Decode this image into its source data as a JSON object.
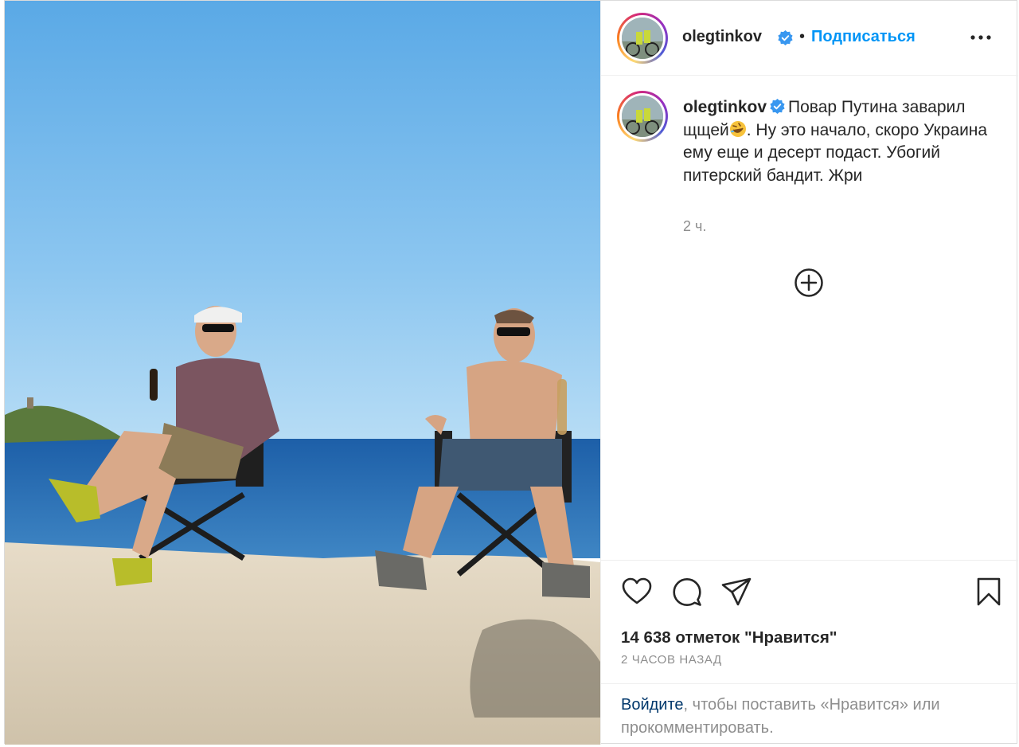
{
  "post": {
    "username": "olegtinkov",
    "follow_label": "Подписаться",
    "separator": "•",
    "more_icon": "more-options-icon",
    "colors": {
      "link_blue": "#0095f6",
      "verified_blue": "#3897f0",
      "muted": "#8e8e8e"
    }
  },
  "caption": {
    "username": "olegtinkov",
    "text_before_emoji": "Повар Путина заварил щщей",
    "emoji": "rolling-on-floor-laughing-emoji",
    "text_after_emoji": ". Ну это начало, скоро Украина ему еще и десерт подаст. Убогий питерский бандит. Жри",
    "time": "2 ч."
  },
  "actions": {
    "like_icon": "heart-icon",
    "comment_icon": "comment-icon",
    "share_icon": "share-icon",
    "save_icon": "bookmark-icon",
    "load_more_icon": "plus-circle-icon"
  },
  "stats": {
    "likes": "14 638 отметок \"Нравится\"",
    "time_ago": "2 ЧАСОВ НАЗАД"
  },
  "login": {
    "link_text": "Войдите",
    "rest_text": ", чтобы поставить «Нравится» или прокомментировать."
  }
}
